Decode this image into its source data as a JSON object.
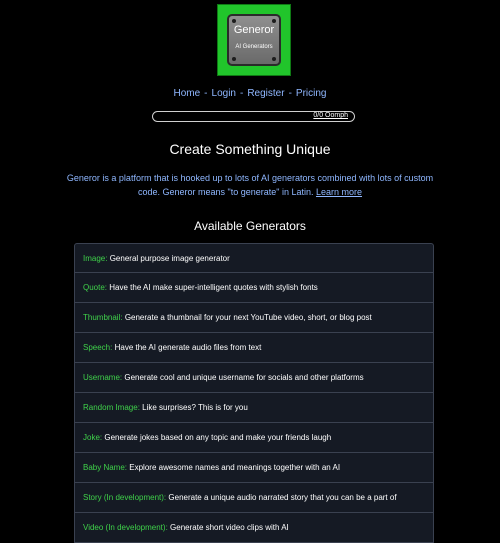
{
  "logo": {
    "title": "Generor",
    "subtitle": "AI Generators"
  },
  "nav": {
    "items": [
      "Home",
      "Login",
      "Register",
      "Pricing"
    ],
    "separator": "-"
  },
  "oomph": {
    "label": "0/0 Oomph"
  },
  "heading": "Create Something Unique",
  "description": {
    "text": "Generor is a platform that is hooked up to lots of AI generators combined with lots of custom code. Generor means \"to generate\" in Latin.",
    "link": "Learn more"
  },
  "generators_heading": "Available Generators",
  "generators": [
    {
      "name": "Image:",
      "text": "General purpose image generator"
    },
    {
      "name": "Quote:",
      "text": "Have the AI make super-intelligent quotes with stylish fonts"
    },
    {
      "name": "Thumbnail:",
      "text": "Generate a thumbnail for your next YouTube video, short, or blog post"
    },
    {
      "name": "Speech:",
      "text": "Have the AI generate audio files from text"
    },
    {
      "name": "Username:",
      "text": "Generate cool and unique username for socials and other platforms"
    },
    {
      "name": "Random Image:",
      "text": "Like surprises? This is for you"
    },
    {
      "name": "Joke:",
      "text": "Generate jokes based on any topic and make your friends laugh"
    },
    {
      "name": "Baby Name:",
      "text": "Explore awesome names and meanings together with an AI"
    },
    {
      "name": "Story (In development):",
      "text": "Generate a unique audio narrated story that you can be a part of"
    },
    {
      "name": "Video (In development):",
      "text": "Generate short video clips with AI"
    }
  ]
}
